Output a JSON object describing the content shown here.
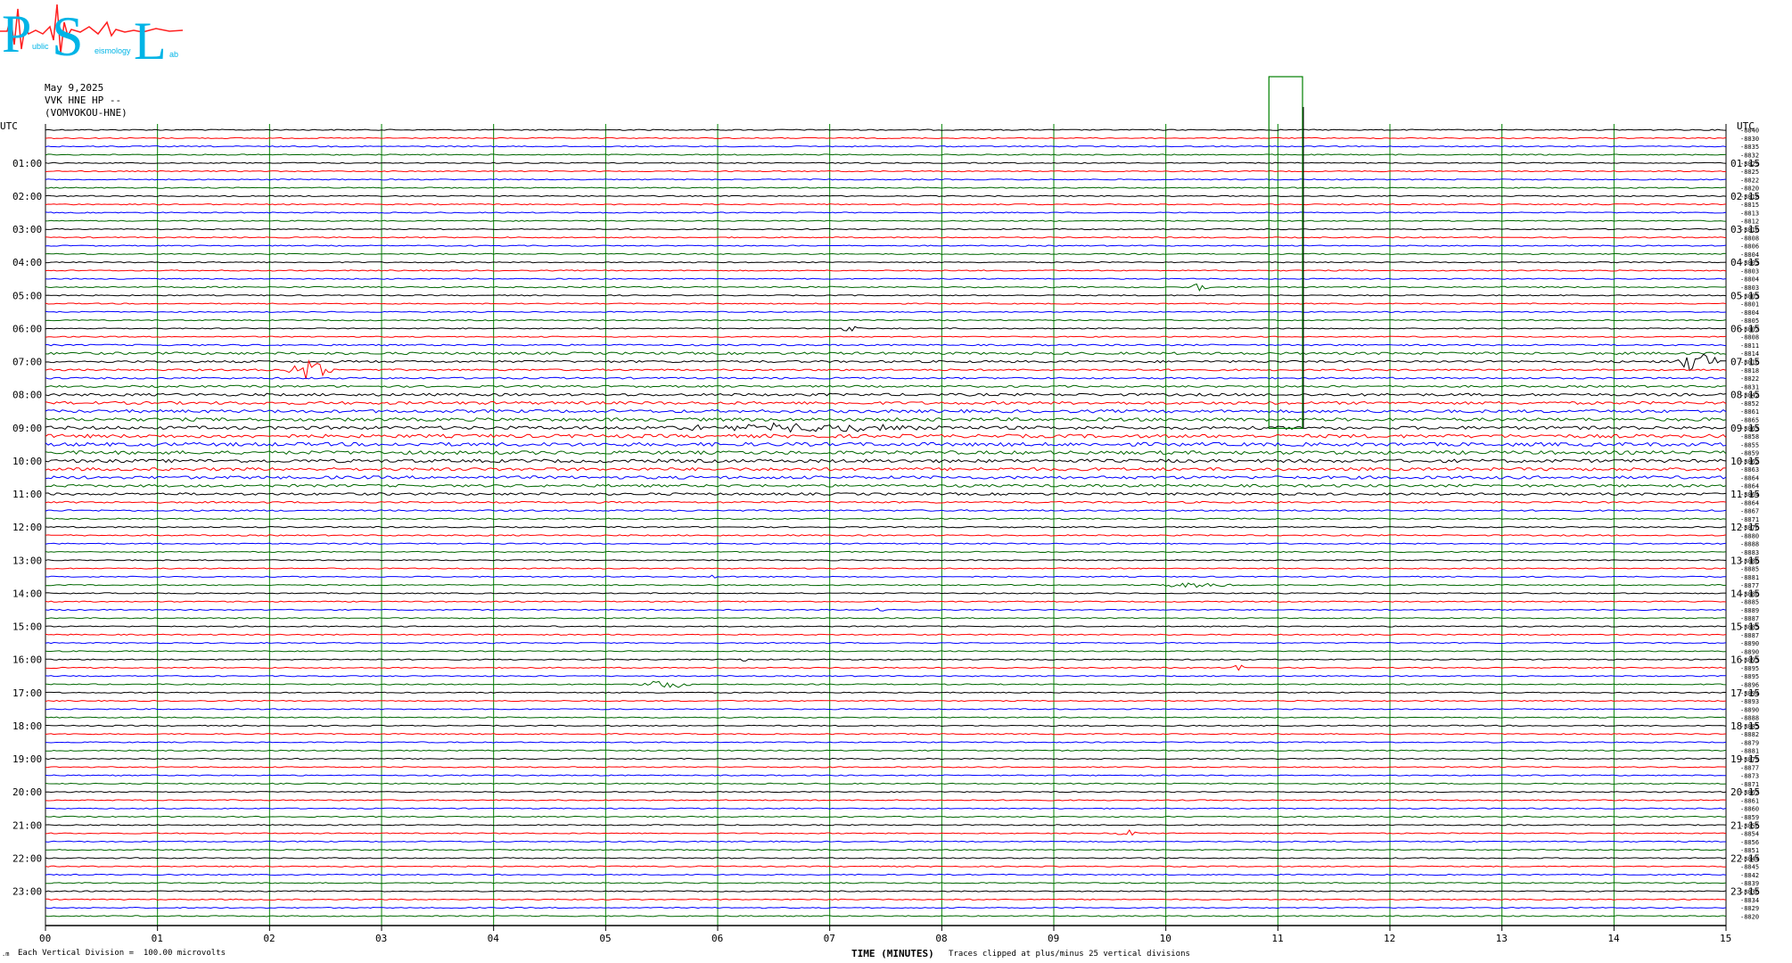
{
  "logo": {
    "letters": [
      "P",
      "S",
      "L"
    ],
    "small_text": [
      "ublic",
      "eismology",
      "ab"
    ]
  },
  "header": {
    "date": "May 9,2025",
    "station": "VVK HNE HP --",
    "location": "(VOMVOKOU-HNE)"
  },
  "axis": {
    "left_unit": "UTC",
    "right_unit": "UTC",
    "x_label": "TIME (MINUTES)",
    "x_ticks": [
      "00",
      "01",
      "02",
      "03",
      "04",
      "05",
      "06",
      "07",
      "08",
      "09",
      "10",
      "11",
      "12",
      "13",
      "14",
      "15"
    ]
  },
  "footer": {
    "left_note": "Each Vertical Division =  100.00 microvolts",
    "right_note": "Traces clipped at plus/minus 25 vertical divisions"
  },
  "colors": {
    "black": "#000000",
    "red": "#ff0000",
    "blue": "#0000ff",
    "green": "#006600",
    "grid": "#008000",
    "logo_red": "#ff2020",
    "logo_cyan": "#00b4e6"
  },
  "chart_data": {
    "type": "line",
    "title": "",
    "xlabel": "TIME (MINUTES)",
    "ylabel": "UTC",
    "xlim": [
      0,
      15
    ],
    "trace_minutes": 15,
    "trace_count": 96,
    "color_cycle": [
      "black",
      "red",
      "blue",
      "green"
    ],
    "left_hour_labels": [
      "01:00",
      "02:00",
      "03:00",
      "04:00",
      "05:00",
      "06:00",
      "07:00",
      "08:00",
      "09:00",
      "10:00",
      "11:00",
      "12:00",
      "13:00",
      "14:00",
      "15:00",
      "16:00",
      "17:00",
      "18:00",
      "19:00",
      "20:00",
      "21:00",
      "22:00",
      "23:00"
    ],
    "right_hour_labels": [
      "01:15",
      "02:15",
      "03:15",
      "04:15",
      "05:15",
      "06:15",
      "07:15",
      "08:15",
      "09:15",
      "10:15",
      "11:15",
      "12:15",
      "13:15",
      "14:15",
      "15:15",
      "16:15",
      "17:15",
      "18:15",
      "19:15",
      "20:15",
      "21:15",
      "22:15",
      "23:15"
    ],
    "trace_offsets": [
      "-8840",
      "-8830",
      "-8835",
      "-8832",
      "-8829",
      "-8825",
      "-8822",
      "-8820",
      "-8818",
      "-8815",
      "-8813",
      "-8812",
      "-8810",
      "-8808",
      "-8806",
      "-8804",
      "-8803",
      "-8803",
      "-8804",
      "-8803",
      "-8803",
      "-8801",
      "-8804",
      "-8805",
      "-8807",
      "-8808",
      "-8811",
      "-8814",
      "-8816",
      "-8818",
      "-8822",
      "-8831",
      "-8842",
      "-8852",
      "-8861",
      "-8865",
      "-8863",
      "-8858",
      "-8855",
      "-8859",
      "-8862",
      "-8863",
      "-8864",
      "-8864",
      "-8864",
      "-8864",
      "-8867",
      "-8871",
      "-8876",
      "-8880",
      "-8888",
      "-8883",
      "-8886",
      "-8885",
      "-8881",
      "-8877",
      "-8880",
      "-8885",
      "-8889",
      "-8887",
      "-8885",
      "-8887",
      "-8890",
      "-8890",
      "-8893",
      "-8895",
      "-8895",
      "-8896",
      "-8894",
      "-8893",
      "-8890",
      "-8888",
      "-8885",
      "-8882",
      "-8879",
      "-8881",
      "-8879",
      "-8877",
      "-8873",
      "-8871",
      "-8867",
      "-8861",
      "-8860",
      "-8859",
      "-8856",
      "-8854",
      "-8856",
      "-8851",
      "-8844",
      "-8845",
      "-8842",
      "-8839",
      "-8836",
      "-8834",
      "-8829",
      "-8820",
      "-8817"
    ],
    "noise_levels": [
      1,
      1,
      1,
      1,
      1,
      1,
      1,
      1,
      1,
      1,
      1,
      1,
      1,
      1,
      1,
      1,
      1,
      1,
      1,
      1.2,
      1,
      1,
      1,
      1,
      1,
      1,
      1.4,
      2.2,
      2.0,
      1.6,
      1.6,
      1.8,
      2.4,
      2.6,
      2.8,
      3.0,
      3.0,
      3.2,
      3.4,
      3.2,
      3.0,
      2.8,
      2.8,
      2.4,
      2.2,
      1.6,
      1.4,
      1.2,
      1.2,
      1.2,
      1.1,
      1,
      1,
      1,
      1,
      1,
      1,
      1,
      1,
      1,
      1,
      1,
      1,
      1,
      1,
      1,
      1,
      1,
      1,
      1,
      1,
      1,
      1,
      1,
      1,
      1,
      1,
      1,
      1,
      1,
      1,
      1,
      1,
      1,
      1,
      1,
      1,
      1,
      1,
      1,
      1,
      1,
      1,
      1,
      1,
      1
    ],
    "events": [
      {
        "trace": 29,
        "minute": 2.35,
        "amplitude": 12,
        "duration": 0.25
      },
      {
        "trace": 28,
        "minute": 14.75,
        "amplitude": 20,
        "duration": 0.2
      },
      {
        "trace": 24,
        "minute": 7.2,
        "amplitude": 4,
        "duration": 0.15
      },
      {
        "trace": 19,
        "minute": 10.3,
        "amplitude": 5,
        "duration": 0.1
      },
      {
        "trace": 55,
        "minute": 10.25,
        "amplitude": 3,
        "duration": 0.5
      },
      {
        "trace": 58,
        "minute": 7.45,
        "amplitude": 8,
        "duration": 0.05
      },
      {
        "trace": 54,
        "minute": 5.95,
        "amplitude": 4,
        "duration": 0.05
      },
      {
        "trace": 67,
        "minute": 5.55,
        "amplitude": 5,
        "duration": 0.3
      },
      {
        "trace": 65,
        "minute": 10.65,
        "amplitude": 4,
        "duration": 0.08
      },
      {
        "trace": 64,
        "minute": 6.25,
        "amplitude": 4,
        "duration": 0.05
      },
      {
        "trace": 85,
        "minute": 9.65,
        "amplitude": 5,
        "duration": 0.12
      },
      {
        "trace": 36,
        "minute": 6.8,
        "amplitude": 5,
        "duration": 1.5
      }
    ],
    "clipped_glitch": {
      "minute_start": 10.92,
      "minute_end": 11.22,
      "top_trace": 0,
      "bottom_trace": 37
    }
  }
}
